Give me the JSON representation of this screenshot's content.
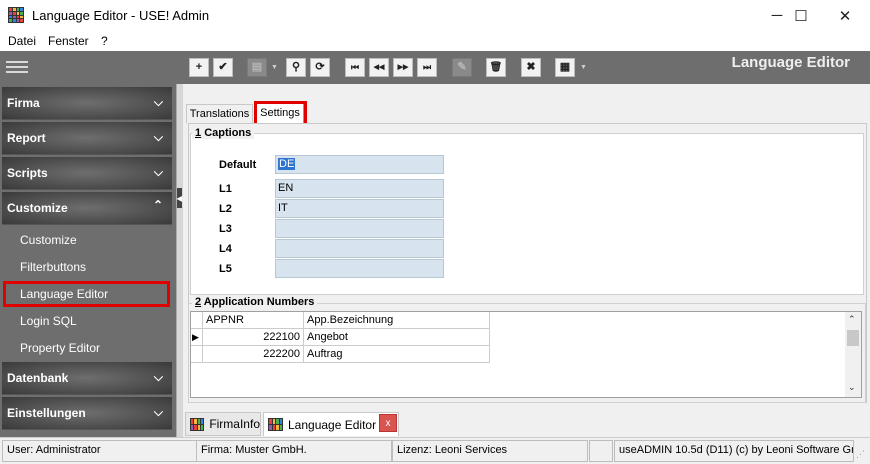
{
  "window": {
    "title": "Language Editor - USE! Admin",
    "minimize_glyph": "─",
    "maximize_glyph": "☐",
    "close_glyph": "✕"
  },
  "menu": [
    "Datei",
    "Fenster",
    "?"
  ],
  "toolbar": {
    "module_title": "Language Editor",
    "buttons": [
      {
        "icon": "add-icon",
        "glyph": "+",
        "enabled": true
      },
      {
        "icon": "check-icon",
        "glyph": "✔",
        "enabled": true
      },
      {
        "icon": "print-icon",
        "glyph": "▤",
        "enabled": false
      },
      {
        "icon": "search-icon",
        "glyph": "⚲",
        "enabled": true
      },
      {
        "icon": "refresh-icon",
        "glyph": "⟳",
        "enabled": true
      },
      {
        "icon": "first-record-icon",
        "glyph": "⏮",
        "enabled": true
      },
      {
        "icon": "previous-record-icon",
        "glyph": "◀◀",
        "enabled": true
      },
      {
        "icon": "next-record-icon",
        "glyph": "▶▶",
        "enabled": true
      },
      {
        "icon": "last-record-icon",
        "glyph": "⏭",
        "enabled": true
      },
      {
        "icon": "edit-icon",
        "glyph": "✎",
        "enabled": false
      },
      {
        "icon": "delete-icon",
        "glyph": "🗑",
        "enabled": true
      },
      {
        "icon": "cancel-icon",
        "glyph": "✖",
        "enabled": true
      },
      {
        "icon": "grid-view-icon",
        "glyph": "▦",
        "enabled": true
      }
    ]
  },
  "sidebar": {
    "sections": [
      {
        "label": "Firma",
        "expanded": false
      },
      {
        "label": "Report",
        "expanded": false
      },
      {
        "label": "Scripts",
        "expanded": false
      },
      {
        "label": "Customize",
        "expanded": true
      },
      {
        "label": "Datenbank",
        "expanded": false
      },
      {
        "label": "Einstellungen",
        "expanded": false
      }
    ],
    "customize_items": [
      "Customize",
      "Filterbuttons",
      "Language Editor",
      "Login SQL",
      "Property Editor"
    ],
    "selected_item": "Language Editor"
  },
  "tabs": [
    "Translations",
    "Settings"
  ],
  "active_tab": "Settings",
  "captions": {
    "group_number": "1",
    "group_label": "Captions",
    "fields": [
      {
        "label": "Default",
        "value": "DE"
      },
      {
        "label": "L1",
        "value": "EN"
      },
      {
        "label": "L2",
        "value": "IT"
      },
      {
        "label": "L3",
        "value": ""
      },
      {
        "label": "L4",
        "value": ""
      },
      {
        "label": "L5",
        "value": ""
      }
    ]
  },
  "application_numbers": {
    "group_number": "2",
    "group_label": "Application Numbers",
    "columns": [
      "APPNR",
      "App.Bezeichnung"
    ],
    "rows": [
      {
        "appnr": "222100",
        "name": "Angebot",
        "current": true
      },
      {
        "appnr": "222200",
        "name": "Auftrag",
        "current": false
      }
    ]
  },
  "document_tabs": [
    {
      "label": "FirmaInfo",
      "active": false
    },
    {
      "label": "Language Editor",
      "active": true
    }
  ],
  "status": {
    "user": "User: Administrator",
    "company": "Firma: Muster GmbH.",
    "license": "Lizenz: Leoni Services",
    "version": "useADMIN 10.5d (D11) (c) by Leoni Software Gm"
  },
  "colors": {
    "sidebar_bg": "#6e6e6e",
    "highlight_red": "#e00000",
    "input_bg": "#d7e3ee",
    "selection_blue": "#2e74d1"
  }
}
